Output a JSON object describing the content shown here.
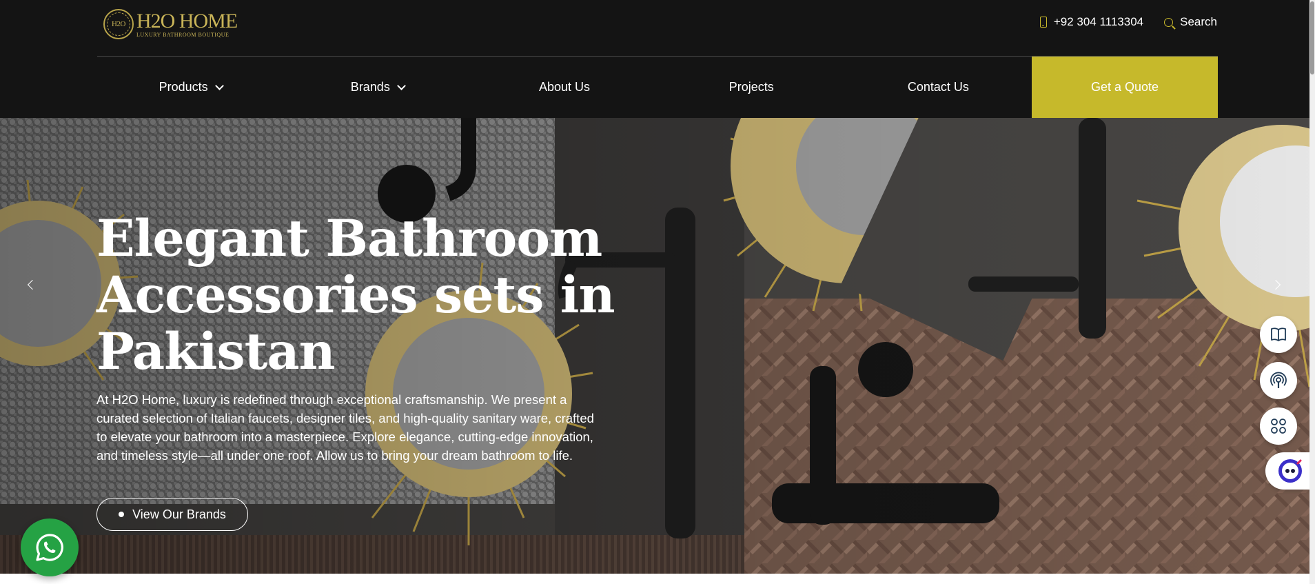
{
  "brand": {
    "logo_mark": "H2O",
    "name": "H2O HOME",
    "tagline": "LUXURY BATHROOM BOUTIQUE",
    "accent_color": "#c6b92b"
  },
  "header": {
    "phone": "+92 304 1113304",
    "search_label": "Search"
  },
  "nav": {
    "items": [
      {
        "label": "Products",
        "has_dropdown": true
      },
      {
        "label": "Brands",
        "has_dropdown": true
      },
      {
        "label": "About Us",
        "has_dropdown": false
      },
      {
        "label": "Projects",
        "has_dropdown": false
      },
      {
        "label": "Contact Us",
        "has_dropdown": false
      }
    ],
    "cta_label": "Get a Quote"
  },
  "hero": {
    "title_lines": [
      "Elegant Bathroom",
      "Accessories sets in",
      "Pakistan"
    ],
    "description": "At H2O Home, luxury is redefined through exceptional craftsmanship. We present a curated selection of Italian faucets, designer tiles, and high-quality sanitary ware, crafted to elevate your bathroom into a masterpiece. Explore elegance, cutting-edge innovation, and timeless style—all under one roof. Allow us to bring your dream bathroom to life.",
    "button_label": "View Our Brands"
  },
  "widgets": {
    "side_icons": [
      "book-icon",
      "podcast-icon",
      "apps-grid-icon",
      "chat-bot-icon"
    ],
    "whatsapp_icon": "whatsapp-icon",
    "whatsapp_color": "#25a244"
  }
}
